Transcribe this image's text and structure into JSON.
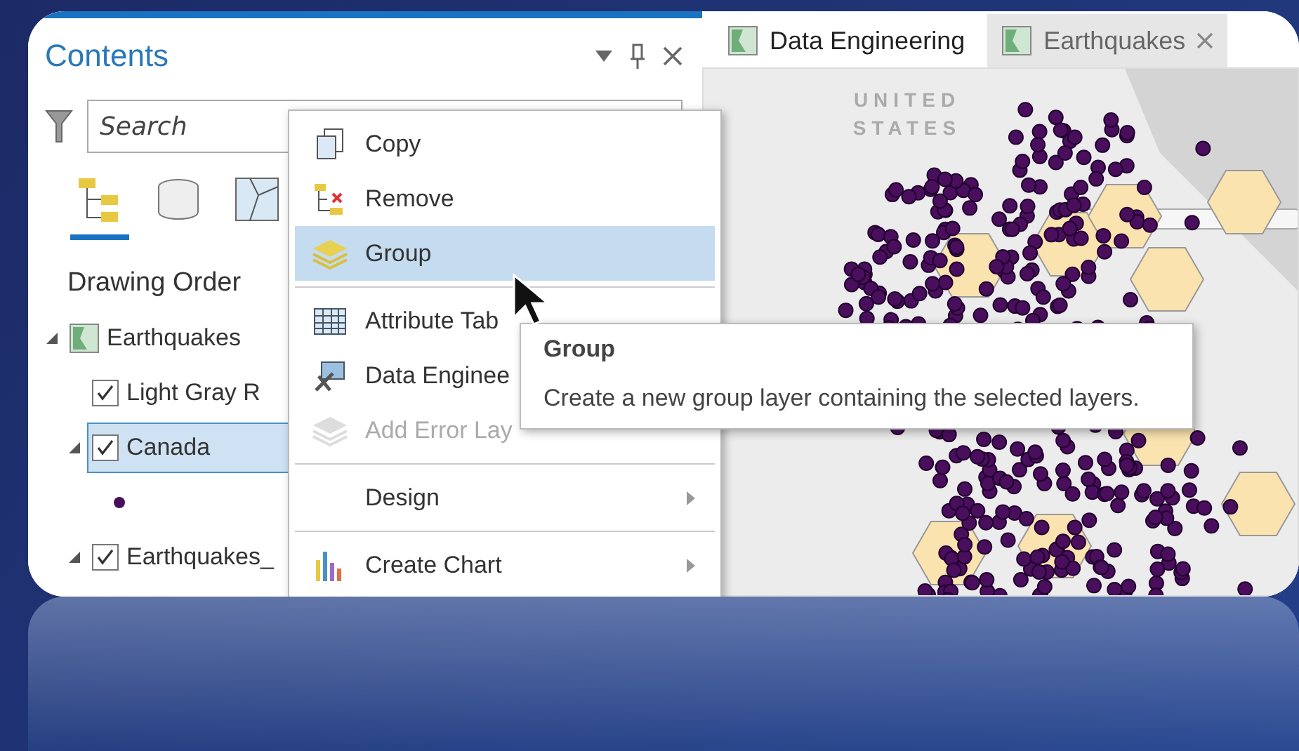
{
  "contents": {
    "title": "Contents",
    "search": {
      "placeholder": "Search"
    },
    "view_tabs": [
      {
        "kind": "drawing-order",
        "selected": true
      },
      {
        "kind": "data-source",
        "selected": false
      },
      {
        "kind": "selection",
        "selected": false
      }
    ],
    "heading": "Drawing Order",
    "layers": [
      {
        "kind": "map",
        "name": "Earthquakes",
        "expanded": true,
        "selected": false,
        "children": [
          {
            "kind": "layer",
            "name": "Light Gray R",
            "checked": true,
            "selected": false
          },
          {
            "kind": "layer",
            "name": "Canada",
            "checked": true,
            "expanded": true,
            "selected": true,
            "children": [
              {
                "kind": "symbol",
                "color": "#4a0f5c"
              }
            ]
          },
          {
            "kind": "layer",
            "name": "Earthquakes_",
            "checked": true,
            "expanded": true,
            "selected": false
          }
        ]
      }
    ]
  },
  "map_tabs": [
    {
      "label": "Data Engineering",
      "selected": true,
      "closable": false
    },
    {
      "label": "Earthquakes",
      "selected": false,
      "closable": true
    }
  ],
  "map": {
    "label": "UNITED STATES"
  },
  "context_menu": [
    {
      "kind": "item",
      "label": "Copy",
      "selected": false,
      "disabled": false,
      "submenu": false
    },
    {
      "kind": "item",
      "label": "Remove",
      "selected": false,
      "disabled": false,
      "submenu": false
    },
    {
      "kind": "item",
      "label": "Group",
      "selected": true,
      "disabled": false,
      "submenu": false
    },
    {
      "kind": "separator"
    },
    {
      "kind": "item",
      "label": "Attribute Tab",
      "selected": false,
      "disabled": false
    },
    {
      "kind": "item",
      "label": "Data Enginee",
      "selected": false,
      "disabled": false
    },
    {
      "kind": "item",
      "label": "Add Error Lay",
      "selected": false,
      "disabled": true
    },
    {
      "kind": "separator"
    },
    {
      "kind": "item",
      "label": "Design",
      "selected": false,
      "disabled": false,
      "submenu": true
    },
    {
      "kind": "separator"
    },
    {
      "kind": "item",
      "label": "Create Chart",
      "selected": false,
      "disabled": false,
      "submenu": true
    }
  ],
  "tooltip": {
    "title": "Group",
    "text": "Create a new group layer containing the selected layers."
  }
}
